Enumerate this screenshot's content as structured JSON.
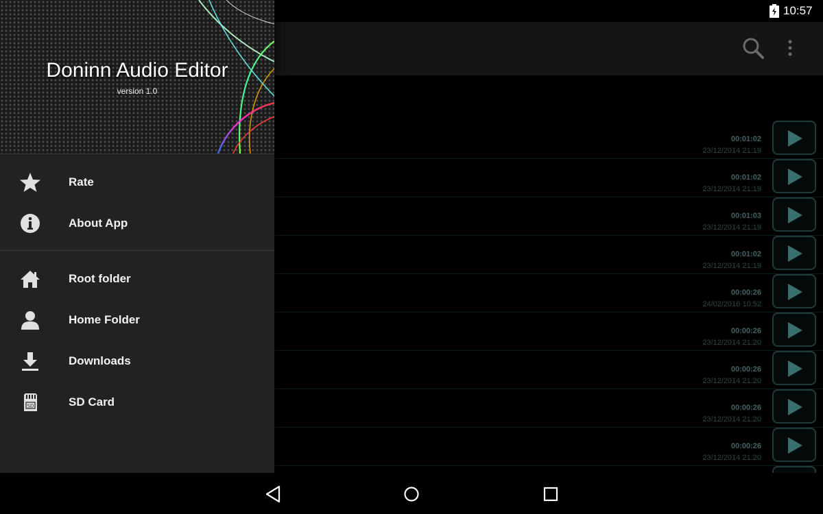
{
  "status_bar": {
    "time": "10:57"
  },
  "app": {
    "title": "Doninn Audio Editor",
    "version": "version 1.0"
  },
  "toolbar": {
    "search_icon": "search-icon",
    "menu_icon": "more-vert-icon"
  },
  "drawer": {
    "items": [
      {
        "label": "Rate",
        "icon": "star-icon"
      },
      {
        "label": "About App",
        "icon": "info-icon"
      },
      {
        "label": "Root folder",
        "icon": "home-icon"
      },
      {
        "label": "Home Folder",
        "icon": "person-icon"
      },
      {
        "label": "Downloads",
        "icon": "download-icon"
      },
      {
        "label": "SD Card",
        "icon": "sd-card-icon"
      }
    ]
  },
  "files": [
    {
      "duration": "00:01:02",
      "date": "23/12/2014 21:19"
    },
    {
      "duration": "00:01:02",
      "date": "23/12/2014 21:19"
    },
    {
      "duration": "00:01:03",
      "date": "23/12/2014 21:19"
    },
    {
      "duration": "00:01:02",
      "date": "23/12/2014 21:19"
    },
    {
      "duration": "00:00:26",
      "date": "24/02/2016 10:52"
    },
    {
      "duration": "00:00:26",
      "date": "23/12/2014 21:20"
    },
    {
      "duration": "00:00:26",
      "date": "23/12/2014 21:20"
    },
    {
      "duration": "00:00:26",
      "date": "23/12/2014 21:20"
    },
    {
      "duration": "00:00:26",
      "date": "23/12/2014 21:20"
    }
  ],
  "colors": {
    "accent": "#3d6363",
    "drawer_bg": "#222222"
  }
}
